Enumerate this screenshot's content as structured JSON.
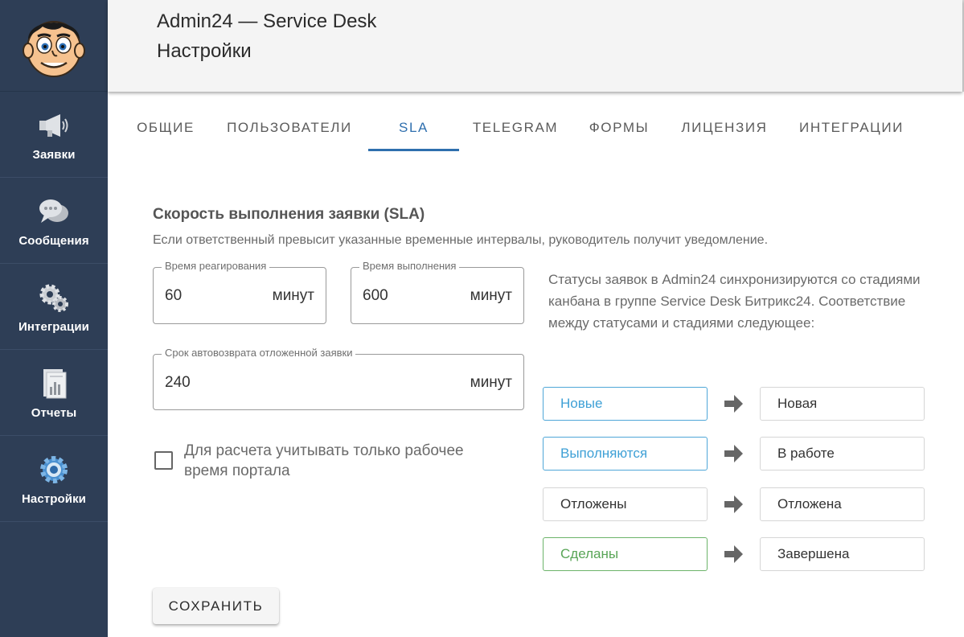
{
  "header": {
    "title": "Admin24 — Service Desk",
    "subtitle": "Настройки"
  },
  "sidebar": {
    "avatar_icon": "cartoon-face-avatar",
    "items": [
      {
        "label": "Заявки",
        "icon": "megaphone-icon"
      },
      {
        "label": "Сообщения",
        "icon": "chat-bubble-icon"
      },
      {
        "label": "Интеграции",
        "icon": "gears-icon"
      },
      {
        "label": "Отчеты",
        "icon": "report-chart-icon"
      },
      {
        "label": "Настройки",
        "icon": "gear-icon"
      }
    ]
  },
  "tabs": [
    {
      "label": "ОБЩИЕ"
    },
    {
      "label": "ПОЛЬЗОВАТЕЛИ"
    },
    {
      "label": "SLA",
      "active": true
    },
    {
      "label": "TELEGRAM"
    },
    {
      "label": "ФОРМЫ"
    },
    {
      "label": "ЛИЦЕНЗИЯ"
    },
    {
      "label": "ИНТЕГРАЦИИ"
    }
  ],
  "sla": {
    "title": "Скорость выполнения заявки (SLA)",
    "description": "Если ответственный превысит указанные временные интервалы, руководитель получит уведомление.",
    "reaction": {
      "label": "Время реагирования",
      "value": "60",
      "unit": "минут"
    },
    "execution": {
      "label": "Время выполнения",
      "value": "600",
      "unit": "минут"
    },
    "autoreturn": {
      "label": "Срок автовозврата отложенной заявки",
      "value": "240",
      "unit": "минут"
    },
    "working_time_label": "Для расчета учитывать только рабочее время портала",
    "working_time_checked": false
  },
  "sync": {
    "text": "Статусы заявок в Admin24 синхронизируются со стадиями канбана в группе Service Desk Битрикс24. Соответствие между статусами и стадиями следующее:",
    "mappings": [
      {
        "status": "Новые",
        "stage": "Новая",
        "color": "#3ea0d6"
      },
      {
        "status": "Выполняются",
        "stage": "В работе",
        "color": "#3ea0d6"
      },
      {
        "status": "Отложены",
        "stage": "Отложена",
        "color": "#333333"
      },
      {
        "status": "Сделаны",
        "stage": "Завершена",
        "color": "#59a557"
      }
    ]
  },
  "actions": {
    "save_label": "СОХРАНИТЬ"
  },
  "colors": {
    "sidebar_bg": "#2e3e56",
    "accent": "#2f6fae",
    "header_bg": "#f4f4f4"
  }
}
